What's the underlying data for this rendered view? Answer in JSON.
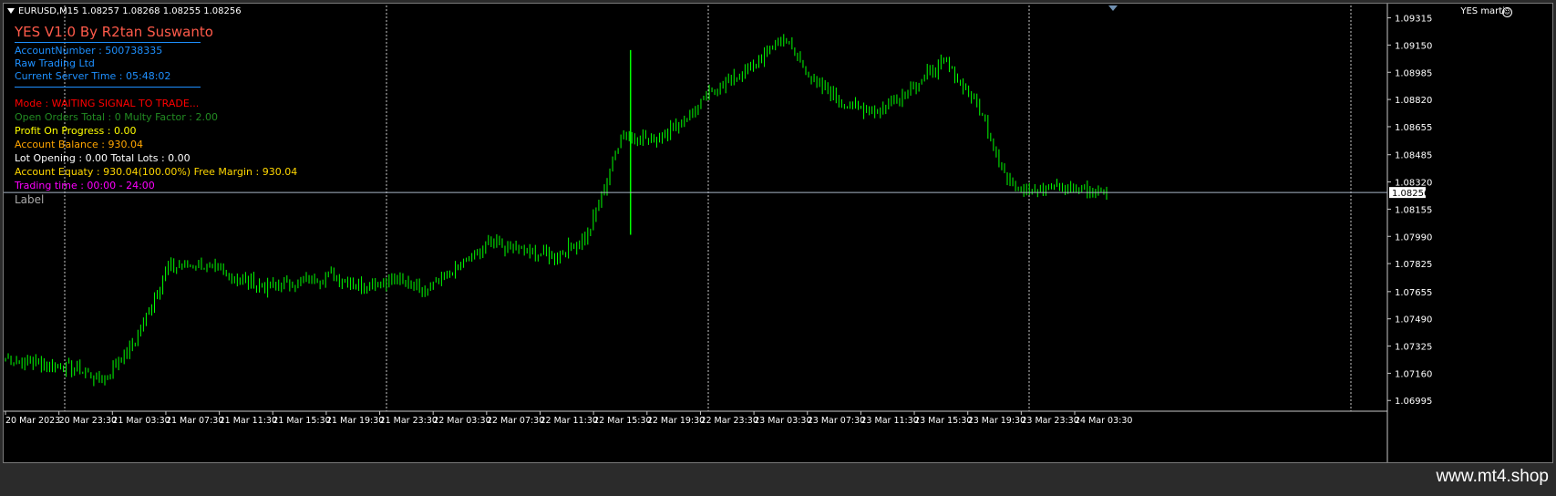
{
  "header": {
    "symbol_info": "EURUSD,M15  1.08257 1.08268 1.08255 1.08256",
    "ea_name": "YES marti"
  },
  "panel": {
    "title": "YES V1.0  By R2tan Suswanto",
    "account_number": "AccountNumber : 500738335",
    "broker": "Raw Trading Ltd",
    "server_time": "Current Server Time : 05:48:02",
    "mode": "Mode : WAITING SIGNAL TO TRADE...",
    "open_orders": "Open Orders Total : 0 Multy Factor : 2.00",
    "profit": "Profit On Progress  : 0.00",
    "balance": "Account Balance : 930.04",
    "lot_opening": "Lot Opening : 0.00  Total Lots : 0.00",
    "equity": "Account Equaty : 930.04(100.00%) Free Margin  : 930.04",
    "trading_time": "Trading time : 00:00 - 24:00",
    "label": "Label",
    "colors": {
      "title": "#ff5a4a",
      "info": "#1e90ff",
      "mode": "#ff0000",
      "orders": "#228b22",
      "profit": "#ffff00",
      "balance": "#ffa500",
      "lots": "#ffffff",
      "equity": "#ffd700",
      "time": "#ff00ff",
      "label": "#a9a9a9"
    }
  },
  "price_axis": {
    "ticks": [
      "1.09315",
      "1.09150",
      "1.08985",
      "1.08820",
      "1.08655",
      "1.08485",
      "1.08320",
      "1.08155",
      "1.07990",
      "1.07825",
      "1.07655",
      "1.07490",
      "1.07325",
      "1.07160",
      "1.06995"
    ],
    "current_price": "1.08256"
  },
  "time_axis": {
    "ticks": [
      "20 Mar 2023",
      "20 Mar 23:30",
      "21 Mar 03:30",
      "21 Mar 07:30",
      "21 Mar 11:30",
      "21 Mar 15:30",
      "21 Mar 19:30",
      "21 Mar 23:30",
      "22 Mar 03:30",
      "22 Mar 07:30",
      "22 Mar 11:30",
      "22 Mar 15:30",
      "22 Mar 19:30",
      "22 Mar 23:30",
      "23 Mar 03:30",
      "23 Mar 07:30",
      "23 Mar 11:30",
      "23 Mar 15:30",
      "23 Mar 19:30",
      "23 Mar 23:30",
      "24 Mar 03:30"
    ]
  },
  "watermark": "www.mt4.shop",
  "chart_data": {
    "type": "line",
    "symbol": "EURUSD",
    "timeframe": "M15",
    "ylim": [
      1.0693,
      1.0939
    ],
    "x_labels": [
      "20 Mar 2023",
      "20 Mar 23:30",
      "21 Mar 03:30",
      "21 Mar 07:30",
      "21 Mar 11:30",
      "21 Mar 15:30",
      "21 Mar 19:30",
      "21 Mar 23:30",
      "22 Mar 03:30",
      "22 Mar 07:30",
      "22 Mar 11:30",
      "22 Mar 15:30",
      "22 Mar 19:30",
      "22 Mar 23:30",
      "23 Mar 03:30",
      "23 Mar 07:30",
      "23 Mar 11:30",
      "23 Mar 15:30",
      "23 Mar 19:30",
      "23 Mar 23:30",
      "24 Mar 03:30"
    ],
    "close_values": [
      1.0725,
      1.0722,
      1.072,
      1.0712,
      1.0735,
      1.078,
      1.0782,
      1.0775,
      1.0768,
      1.0771,
      1.0775,
      1.077,
      1.0772,
      1.0768,
      1.078,
      1.0795,
      1.079,
      1.0787,
      1.08,
      1.086,
      1.0858,
      1.087,
      1.089,
      1.09,
      1.092,
      1.0892,
      1.0878,
      1.0875,
      1.089,
      1.0905,
      1.088,
      1.083,
      1.0828,
      1.0828,
      1.0826
    ],
    "current_price": 1.08256,
    "grid": false
  }
}
